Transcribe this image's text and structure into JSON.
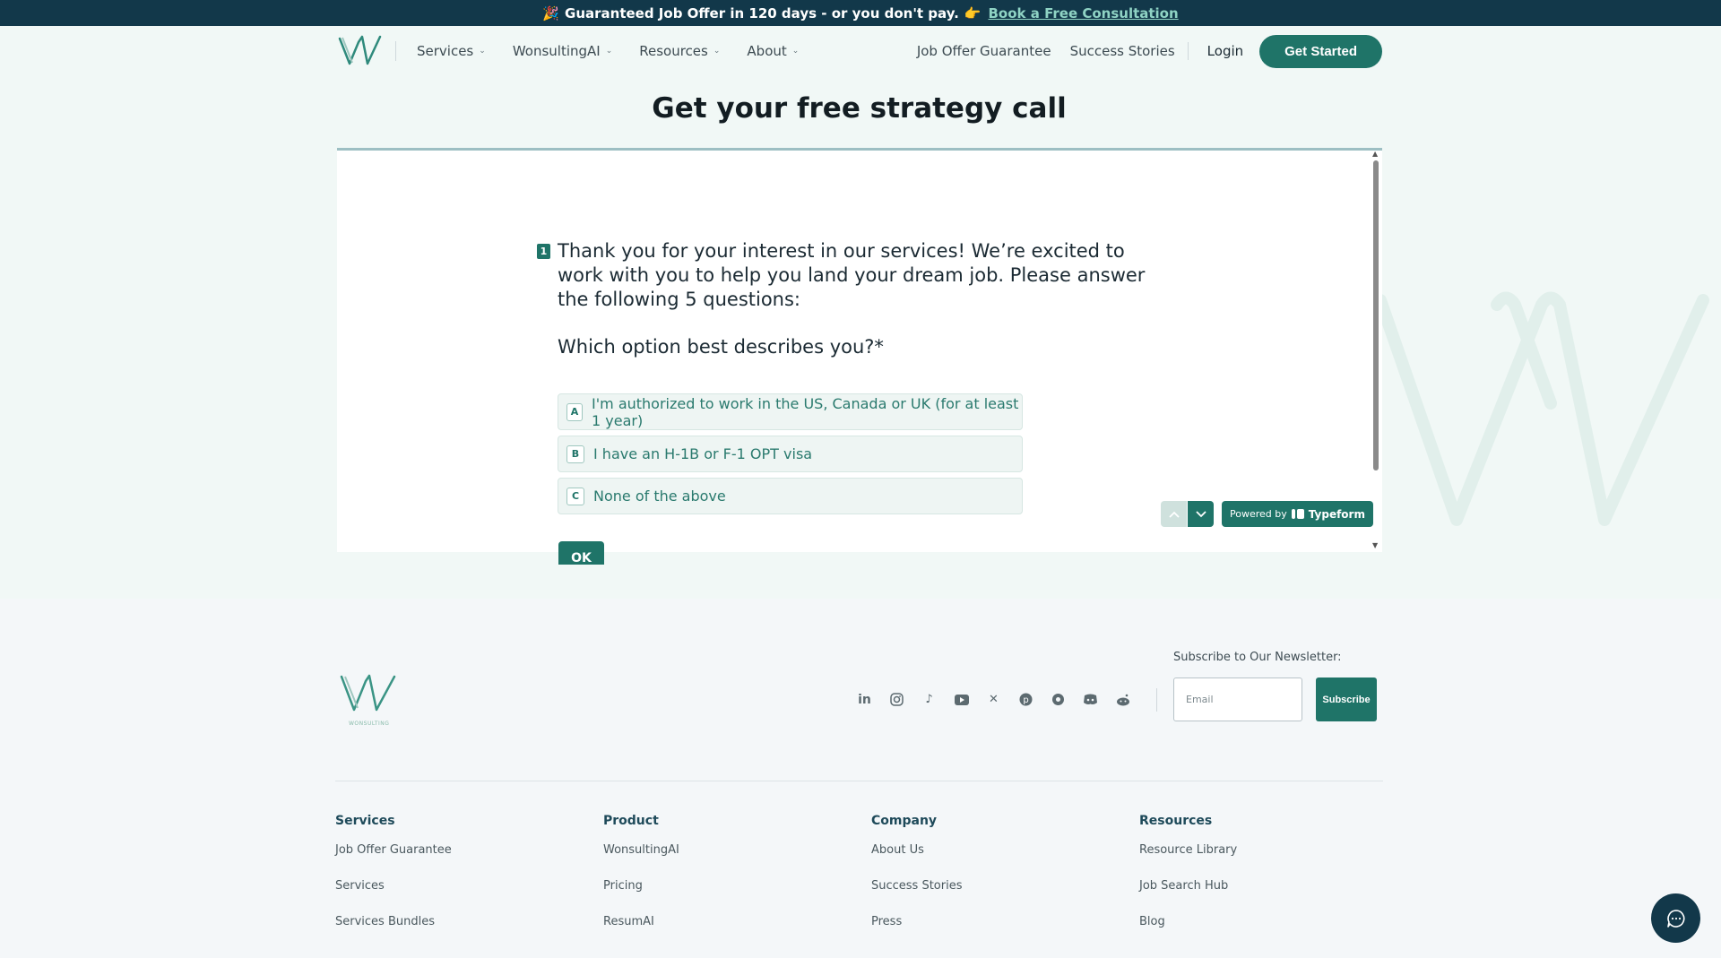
{
  "announcement": {
    "emoji_left": "🎉",
    "text": "Guaranteed Job Offer in 120 days - or you don't pay.",
    "emoji_right": "👉",
    "link": "Book a Free Consultation"
  },
  "header": {
    "nav": [
      {
        "label": "Services"
      },
      {
        "label": "WonsultingAI"
      },
      {
        "label": "Resources"
      },
      {
        "label": "About"
      }
    ],
    "right_links": {
      "job_offer": "Job Offer Guarantee",
      "success": "Success Stories",
      "login": "Login"
    },
    "cta": "Get Started"
  },
  "page": {
    "title": "Get your free strategy call"
  },
  "form": {
    "question_number": "1",
    "intro": "Thank you for your interest in our services! We’re excited to work with you to help you land your dream job. Please answer the following 5 questions:",
    "question": "Which option best describes you?*",
    "options": [
      {
        "key": "A",
        "label": "I'm authorized to work in the US, Canada or UK (for at least 1 year)"
      },
      {
        "key": "B",
        "label": "I have an H-1B or F-1 OPT visa"
      },
      {
        "key": "C",
        "label": "None of the above"
      }
    ],
    "ok_label": "OK",
    "powered_prefix": "Powered by",
    "powered_brand": "Typeform",
    "accent_color": "#1f7468"
  },
  "footer": {
    "logo_text": "WONSULTING",
    "socials": [
      "linkedin-icon",
      "instagram-icon",
      "tiktok-icon",
      "youtube-icon",
      "x-icon",
      "pinterest-icon",
      "threads-icon",
      "discord-icon",
      "reddit-icon"
    ],
    "newsletter_label": "Subscribe to Our Newsletter:",
    "email_placeholder": "Email",
    "subscribe": "Subscribe",
    "columns": [
      {
        "title": "Services",
        "links": [
          "Job Offer Guarantee",
          "Services",
          "Services Bundles"
        ]
      },
      {
        "title": "Product",
        "links": [
          "WonsultingAI",
          "Pricing",
          "ResumAI"
        ]
      },
      {
        "title": "Company",
        "links": [
          "About Us",
          "Success Stories",
          "Press"
        ]
      },
      {
        "title": "Resources",
        "links": [
          "Resource Library",
          "Job Search Hub",
          "Blog"
        ]
      }
    ]
  },
  "colors": {
    "announce_bg": "#12384a",
    "brand_green": "#1f7468",
    "footer_bg": "#f4f7f9"
  }
}
